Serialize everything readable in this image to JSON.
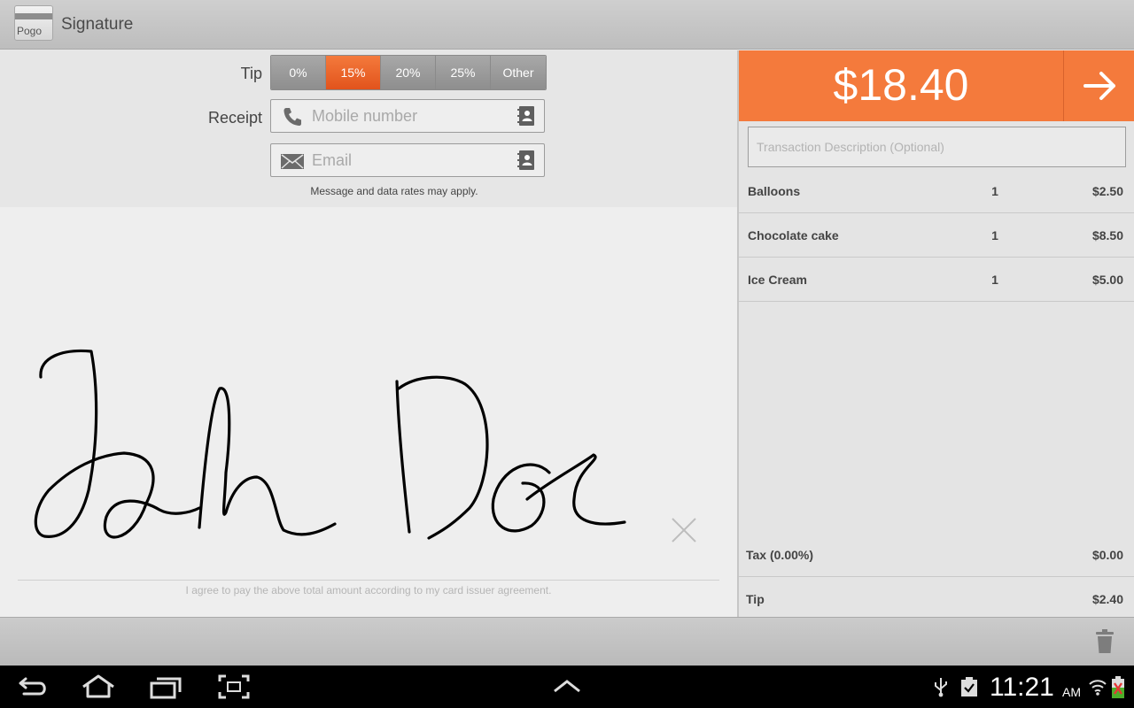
{
  "app": {
    "title": "Signature",
    "logo_text": "Pogo"
  },
  "tip": {
    "label": "Tip",
    "options": [
      "0%",
      "15%",
      "20%",
      "25%",
      "Other"
    ],
    "selected": "15%"
  },
  "receipt": {
    "label": "Receipt",
    "mobile_placeholder": "Mobile number",
    "email_placeholder": "Email",
    "disclaimer": "Message and data rates may apply."
  },
  "signature": {
    "agreement": "I agree to pay the above total amount according to my card issuer agreement."
  },
  "order": {
    "total": "$18.40",
    "description_placeholder": "Transaction Description (Optional)",
    "items": [
      {
        "name": "Balloons",
        "qty": "1",
        "price": "$2.50"
      },
      {
        "name": "Chocolate cake",
        "qty": "1",
        "price": "$8.50"
      },
      {
        "name": "Ice Cream",
        "qty": "1",
        "price": "$5.00"
      }
    ],
    "tax": {
      "label": "Tax (0.00%)",
      "value": "$0.00"
    },
    "tip": {
      "label": "Tip",
      "value": "$2.40"
    }
  },
  "system": {
    "time": "11:21",
    "ampm": "AM"
  },
  "colors": {
    "accent": "#f47a3c",
    "selected_tip": "#e2531c"
  },
  "icons": {
    "back": "back-icon",
    "home": "home-icon",
    "recents": "recent-apps-icon",
    "screenshot": "screenshot-icon",
    "up": "chevron-up-icon",
    "next": "arrow-right-icon",
    "trash": "trash-icon",
    "clear": "close-icon"
  }
}
